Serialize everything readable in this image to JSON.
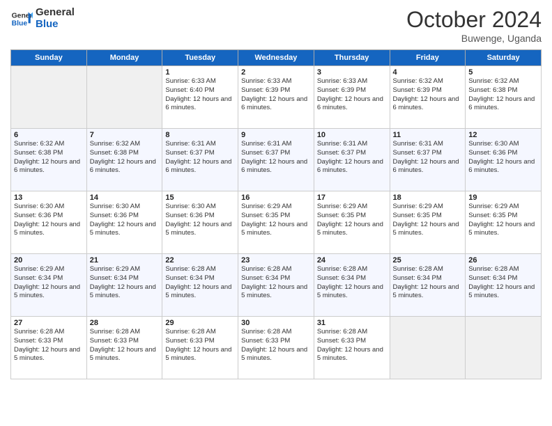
{
  "header": {
    "logo_line1": "General",
    "logo_line2": "Blue",
    "month_title": "October 2024",
    "location": "Buwenge, Uganda"
  },
  "days_of_week": [
    "Sunday",
    "Monday",
    "Tuesday",
    "Wednesday",
    "Thursday",
    "Friday",
    "Saturday"
  ],
  "weeks": [
    [
      {
        "day": "",
        "sunrise": "",
        "sunset": "",
        "daylight": "",
        "empty": true
      },
      {
        "day": "",
        "sunrise": "",
        "sunset": "",
        "daylight": "",
        "empty": true
      },
      {
        "day": "1",
        "sunrise": "Sunrise: 6:33 AM",
        "sunset": "Sunset: 6:40 PM",
        "daylight": "Daylight: 12 hours and 6 minutes.",
        "empty": false
      },
      {
        "day": "2",
        "sunrise": "Sunrise: 6:33 AM",
        "sunset": "Sunset: 6:39 PM",
        "daylight": "Daylight: 12 hours and 6 minutes.",
        "empty": false
      },
      {
        "day": "3",
        "sunrise": "Sunrise: 6:33 AM",
        "sunset": "Sunset: 6:39 PM",
        "daylight": "Daylight: 12 hours and 6 minutes.",
        "empty": false
      },
      {
        "day": "4",
        "sunrise": "Sunrise: 6:32 AM",
        "sunset": "Sunset: 6:39 PM",
        "daylight": "Daylight: 12 hours and 6 minutes.",
        "empty": false
      },
      {
        "day": "5",
        "sunrise": "Sunrise: 6:32 AM",
        "sunset": "Sunset: 6:38 PM",
        "daylight": "Daylight: 12 hours and 6 minutes.",
        "empty": false
      }
    ],
    [
      {
        "day": "6",
        "sunrise": "Sunrise: 6:32 AM",
        "sunset": "Sunset: 6:38 PM",
        "daylight": "Daylight: 12 hours and 6 minutes.",
        "empty": false
      },
      {
        "day": "7",
        "sunrise": "Sunrise: 6:32 AM",
        "sunset": "Sunset: 6:38 PM",
        "daylight": "Daylight: 12 hours and 6 minutes.",
        "empty": false
      },
      {
        "day": "8",
        "sunrise": "Sunrise: 6:31 AM",
        "sunset": "Sunset: 6:37 PM",
        "daylight": "Daylight: 12 hours and 6 minutes.",
        "empty": false
      },
      {
        "day": "9",
        "sunrise": "Sunrise: 6:31 AM",
        "sunset": "Sunset: 6:37 PM",
        "daylight": "Daylight: 12 hours and 6 minutes.",
        "empty": false
      },
      {
        "day": "10",
        "sunrise": "Sunrise: 6:31 AM",
        "sunset": "Sunset: 6:37 PM",
        "daylight": "Daylight: 12 hours and 6 minutes.",
        "empty": false
      },
      {
        "day": "11",
        "sunrise": "Sunrise: 6:31 AM",
        "sunset": "Sunset: 6:37 PM",
        "daylight": "Daylight: 12 hours and 6 minutes.",
        "empty": false
      },
      {
        "day": "12",
        "sunrise": "Sunrise: 6:30 AM",
        "sunset": "Sunset: 6:36 PM",
        "daylight": "Daylight: 12 hours and 6 minutes.",
        "empty": false
      }
    ],
    [
      {
        "day": "13",
        "sunrise": "Sunrise: 6:30 AM",
        "sunset": "Sunset: 6:36 PM",
        "daylight": "Daylight: 12 hours and 5 minutes.",
        "empty": false
      },
      {
        "day": "14",
        "sunrise": "Sunrise: 6:30 AM",
        "sunset": "Sunset: 6:36 PM",
        "daylight": "Daylight: 12 hours and 5 minutes.",
        "empty": false
      },
      {
        "day": "15",
        "sunrise": "Sunrise: 6:30 AM",
        "sunset": "Sunset: 6:36 PM",
        "daylight": "Daylight: 12 hours and 5 minutes.",
        "empty": false
      },
      {
        "day": "16",
        "sunrise": "Sunrise: 6:29 AM",
        "sunset": "Sunset: 6:35 PM",
        "daylight": "Daylight: 12 hours and 5 minutes.",
        "empty": false
      },
      {
        "day": "17",
        "sunrise": "Sunrise: 6:29 AM",
        "sunset": "Sunset: 6:35 PM",
        "daylight": "Daylight: 12 hours and 5 minutes.",
        "empty": false
      },
      {
        "day": "18",
        "sunrise": "Sunrise: 6:29 AM",
        "sunset": "Sunset: 6:35 PM",
        "daylight": "Daylight: 12 hours and 5 minutes.",
        "empty": false
      },
      {
        "day": "19",
        "sunrise": "Sunrise: 6:29 AM",
        "sunset": "Sunset: 6:35 PM",
        "daylight": "Daylight: 12 hours and 5 minutes.",
        "empty": false
      }
    ],
    [
      {
        "day": "20",
        "sunrise": "Sunrise: 6:29 AM",
        "sunset": "Sunset: 6:34 PM",
        "daylight": "Daylight: 12 hours and 5 minutes.",
        "empty": false
      },
      {
        "day": "21",
        "sunrise": "Sunrise: 6:29 AM",
        "sunset": "Sunset: 6:34 PM",
        "daylight": "Daylight: 12 hours and 5 minutes.",
        "empty": false
      },
      {
        "day": "22",
        "sunrise": "Sunrise: 6:28 AM",
        "sunset": "Sunset: 6:34 PM",
        "daylight": "Daylight: 12 hours and 5 minutes.",
        "empty": false
      },
      {
        "day": "23",
        "sunrise": "Sunrise: 6:28 AM",
        "sunset": "Sunset: 6:34 PM",
        "daylight": "Daylight: 12 hours and 5 minutes.",
        "empty": false
      },
      {
        "day": "24",
        "sunrise": "Sunrise: 6:28 AM",
        "sunset": "Sunset: 6:34 PM",
        "daylight": "Daylight: 12 hours and 5 minutes.",
        "empty": false
      },
      {
        "day": "25",
        "sunrise": "Sunrise: 6:28 AM",
        "sunset": "Sunset: 6:34 PM",
        "daylight": "Daylight: 12 hours and 5 minutes.",
        "empty": false
      },
      {
        "day": "26",
        "sunrise": "Sunrise: 6:28 AM",
        "sunset": "Sunset: 6:34 PM",
        "daylight": "Daylight: 12 hours and 5 minutes.",
        "empty": false
      }
    ],
    [
      {
        "day": "27",
        "sunrise": "Sunrise: 6:28 AM",
        "sunset": "Sunset: 6:33 PM",
        "daylight": "Daylight: 12 hours and 5 minutes.",
        "empty": false
      },
      {
        "day": "28",
        "sunrise": "Sunrise: 6:28 AM",
        "sunset": "Sunset: 6:33 PM",
        "daylight": "Daylight: 12 hours and 5 minutes.",
        "empty": false
      },
      {
        "day": "29",
        "sunrise": "Sunrise: 6:28 AM",
        "sunset": "Sunset: 6:33 PM",
        "daylight": "Daylight: 12 hours and 5 minutes.",
        "empty": false
      },
      {
        "day": "30",
        "sunrise": "Sunrise: 6:28 AM",
        "sunset": "Sunset: 6:33 PM",
        "daylight": "Daylight: 12 hours and 5 minutes.",
        "empty": false
      },
      {
        "day": "31",
        "sunrise": "Sunrise: 6:28 AM",
        "sunset": "Sunset: 6:33 PM",
        "daylight": "Daylight: 12 hours and 5 minutes.",
        "empty": false
      },
      {
        "day": "",
        "sunrise": "",
        "sunset": "",
        "daylight": "",
        "empty": true
      },
      {
        "day": "",
        "sunrise": "",
        "sunset": "",
        "daylight": "",
        "empty": true
      }
    ]
  ]
}
